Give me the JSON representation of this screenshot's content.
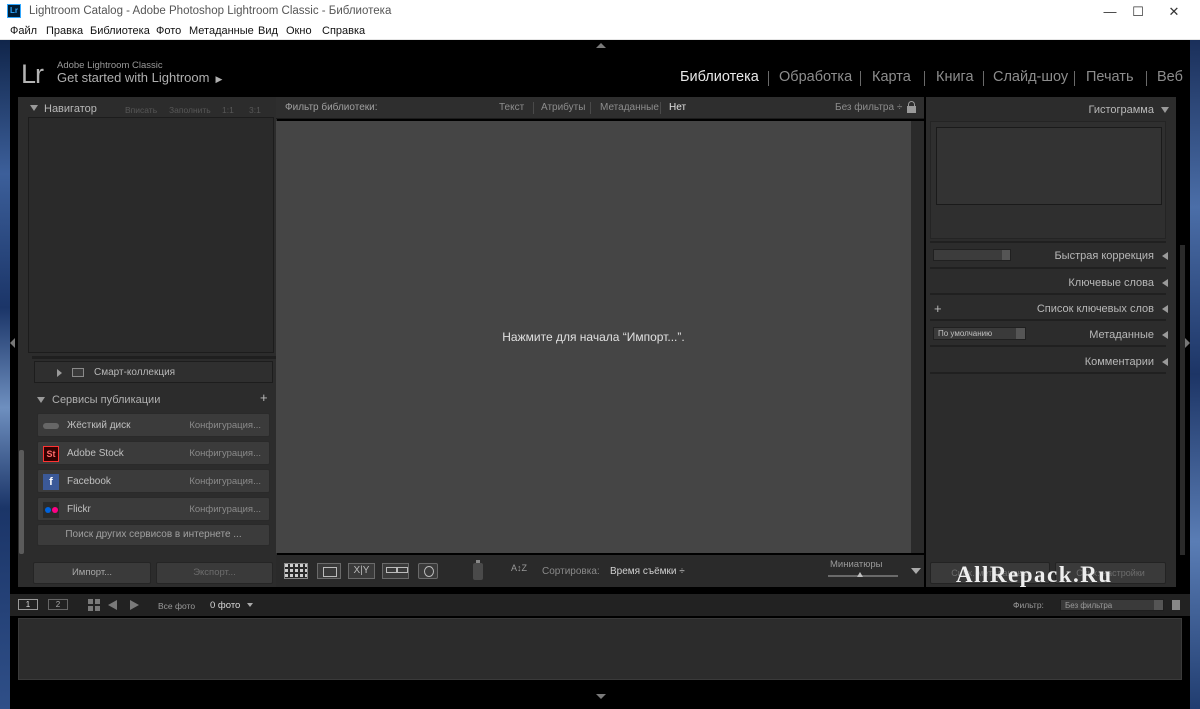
{
  "window": {
    "title": "Lightroom Catalog - Adobe Photoshop Lightroom Classic - Библиотека",
    "app_icon_text": "Lr",
    "minimize": "—",
    "maximize": "☐",
    "close": "✕"
  },
  "menu": [
    "Файл",
    "Правка",
    "Библиотека",
    "Фото",
    "Метаданные",
    "Вид",
    "Окно",
    "Справка"
  ],
  "identity": {
    "logo": "Lr",
    "product": "Adobe Lightroom Classic",
    "tagline": "Get started with Lightroom",
    "tagline_arrow": "▶"
  },
  "modules": [
    "Библиотека",
    "Обработка",
    "Карта",
    "Книга",
    "Слайд-шоу",
    "Печать",
    "Веб"
  ],
  "active_module": "Библиотека",
  "left_panel": {
    "navigator": {
      "title": "Навигатор",
      "options": [
        "Вписать",
        "Заполнить",
        "1:1",
        "3:1"
      ]
    },
    "smart_collection": "Смарт-коллекция",
    "publish": {
      "title": "Сервисы публикации",
      "add": "+",
      "services": [
        {
          "name": "Жёсткий диск",
          "action": "Конфигурация..."
        },
        {
          "name": "Adobe Stock",
          "action": "Конфигурация...",
          "icon": "St"
        },
        {
          "name": "Facebook",
          "action": "Конфигурация...",
          "icon": "f"
        },
        {
          "name": "Flickr",
          "action": "Конфигурация..."
        }
      ],
      "find_more": "Поиск других сервисов в интернете ..."
    },
    "import_btn": "Импорт...",
    "export_btn": "Экспорт..."
  },
  "filter_bar": {
    "label": "Фильтр библиотеки:",
    "tabs": [
      "Текст",
      "Атрибуты",
      "Метаданные",
      "Нет"
    ],
    "active_tab": "Нет",
    "preset": "Без фильтра ÷"
  },
  "grid": {
    "empty_message": "Нажмите для начала “Импорт...”."
  },
  "toolbar": {
    "xy_label": "X|Y",
    "sort_icon": "A↕Z",
    "sort_label": "Сортировка:",
    "sort_value": "Время съёмки ÷",
    "thumbs_label": "Миниатюры",
    "thumb_size": 0.45
  },
  "right_panel": {
    "histogram": "Гистограмма",
    "quick_develop": "Быстрая коррекция",
    "keywords": "Ключевые слова",
    "keyword_list": "Список ключевых слов",
    "keyword_add": "+",
    "metadata": "Метаданные",
    "metadata_preset": "По умолчанию",
    "comments": "Комментарии",
    "sync_meta_btn": "Синх. метаданные",
    "sync_settings_btn": "Синх. настройки"
  },
  "watermark": "AllRepack.Ru",
  "filmstrip": {
    "tab1": "1",
    "tab2": "2",
    "source": "Все фото",
    "count": "0 фото",
    "filter_label": "Фильтр:",
    "filter_value": "Без фильтра"
  }
}
